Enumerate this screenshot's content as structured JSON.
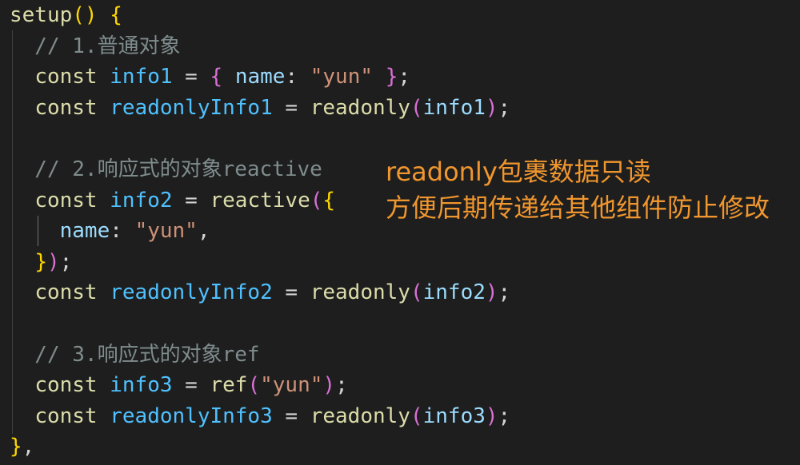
{
  "code": {
    "lines": [
      [
        {
          "t": "setup",
          "c": "c-call"
        },
        {
          "t": "()",
          "c": "c-p1"
        },
        {
          "t": " ",
          "c": "c-plain"
        },
        {
          "t": "{",
          "c": "c-p1"
        }
      ],
      [
        {
          "t": "  // 1.普通对象",
          "c": "c-cm"
        }
      ],
      [
        {
          "t": "  ",
          "c": "c-plain"
        },
        {
          "t": "const",
          "c": "c-kw"
        },
        {
          "t": " ",
          "c": "c-plain"
        },
        {
          "t": "info1",
          "c": "c-var"
        },
        {
          "t": " = ",
          "c": "c-op"
        },
        {
          "t": "{",
          "c": "c-p2"
        },
        {
          "t": " ",
          "c": "c-plain"
        },
        {
          "t": "name",
          "c": "c-prop"
        },
        {
          "t": ": ",
          "c": "c-op"
        },
        {
          "t": "\"yun\"",
          "c": "c-str"
        },
        {
          "t": " ",
          "c": "c-plain"
        },
        {
          "t": "}",
          "c": "c-p2"
        },
        {
          "t": ";",
          "c": "c-op"
        }
      ],
      [
        {
          "t": "  ",
          "c": "c-plain"
        },
        {
          "t": "const",
          "c": "c-kw"
        },
        {
          "t": " ",
          "c": "c-plain"
        },
        {
          "t": "readonlyInfo1",
          "c": "c-var"
        },
        {
          "t": " = ",
          "c": "c-op"
        },
        {
          "t": "readonly",
          "c": "c-call"
        },
        {
          "t": "(",
          "c": "c-p2"
        },
        {
          "t": "info1",
          "c": "c-prop"
        },
        {
          "t": ")",
          "c": "c-p2"
        },
        {
          "t": ";",
          "c": "c-op"
        }
      ],
      [],
      [
        {
          "t": "  // 2.响应式的对象reactive",
          "c": "c-cm"
        }
      ],
      [
        {
          "t": "  ",
          "c": "c-plain"
        },
        {
          "t": "const",
          "c": "c-kw"
        },
        {
          "t": " ",
          "c": "c-plain"
        },
        {
          "t": "info2",
          "c": "c-var"
        },
        {
          "t": " = ",
          "c": "c-op"
        },
        {
          "t": "reactive",
          "c": "c-call"
        },
        {
          "t": "(",
          "c": "c-p2"
        },
        {
          "t": "{",
          "c": "c-p1"
        }
      ],
      [
        {
          "t": "    ",
          "c": "c-plain"
        },
        {
          "t": "name",
          "c": "c-prop"
        },
        {
          "t": ": ",
          "c": "c-op"
        },
        {
          "t": "\"yun\"",
          "c": "c-str"
        },
        {
          "t": ",",
          "c": "c-op"
        }
      ],
      [
        {
          "t": "  ",
          "c": "c-plain"
        },
        {
          "t": "}",
          "c": "c-p1"
        },
        {
          "t": ")",
          "c": "c-p2"
        },
        {
          "t": ";",
          "c": "c-op"
        }
      ],
      [
        {
          "t": "  ",
          "c": "c-plain"
        },
        {
          "t": "const",
          "c": "c-kw"
        },
        {
          "t": " ",
          "c": "c-plain"
        },
        {
          "t": "readonlyInfo2",
          "c": "c-var"
        },
        {
          "t": " = ",
          "c": "c-op"
        },
        {
          "t": "readonly",
          "c": "c-call"
        },
        {
          "t": "(",
          "c": "c-p2"
        },
        {
          "t": "info2",
          "c": "c-prop"
        },
        {
          "t": ")",
          "c": "c-p2"
        },
        {
          "t": ";",
          "c": "c-op"
        }
      ],
      [],
      [
        {
          "t": "  // 3.响应式的对象ref",
          "c": "c-cm"
        }
      ],
      [
        {
          "t": "  ",
          "c": "c-plain"
        },
        {
          "t": "const",
          "c": "c-kw"
        },
        {
          "t": " ",
          "c": "c-plain"
        },
        {
          "t": "info3",
          "c": "c-var"
        },
        {
          "t": " = ",
          "c": "c-op"
        },
        {
          "t": "ref",
          "c": "c-call"
        },
        {
          "t": "(",
          "c": "c-p2"
        },
        {
          "t": "\"yun\"",
          "c": "c-str"
        },
        {
          "t": ")",
          "c": "c-p2"
        },
        {
          "t": ";",
          "c": "c-op"
        }
      ],
      [
        {
          "t": "  ",
          "c": "c-plain"
        },
        {
          "t": "const",
          "c": "c-kw"
        },
        {
          "t": " ",
          "c": "c-plain"
        },
        {
          "t": "readonlyInfo3",
          "c": "c-var"
        },
        {
          "t": " = ",
          "c": "c-op"
        },
        {
          "t": "readonly",
          "c": "c-call"
        },
        {
          "t": "(",
          "c": "c-p2"
        },
        {
          "t": "info3",
          "c": "c-prop"
        },
        {
          "t": ")",
          "c": "c-p2"
        },
        {
          "t": ";",
          "c": "c-op"
        }
      ],
      [
        {
          "t": "}",
          "c": "c-p1"
        },
        {
          "t": ",",
          "c": "c-op"
        }
      ]
    ]
  },
  "annotation": {
    "line1": "readonly包裹数据只读",
    "line2": "方便后期传递给其他组件防止修改"
  },
  "colors": {
    "background": "#1e1e1e",
    "annotation": "#f0962e",
    "keyword": "#dcdcaa",
    "variable": "#4fc1ff",
    "property": "#9cdcfe",
    "string": "#ce9178",
    "comment": "#7f8c8d"
  }
}
